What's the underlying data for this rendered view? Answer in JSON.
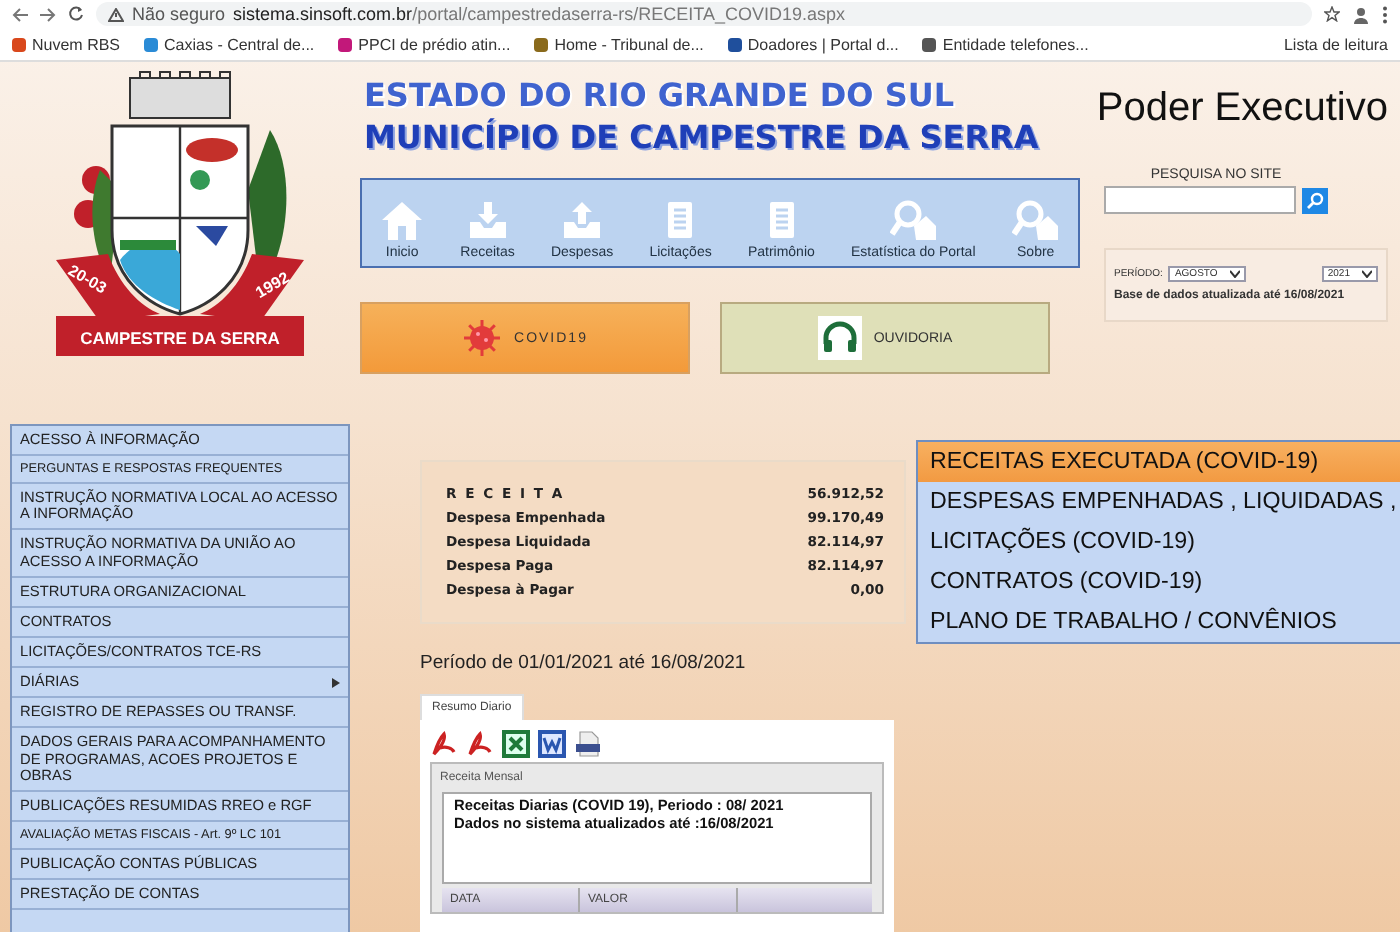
{
  "browser": {
    "security": "Não seguro",
    "url_host": "sistema.sinsoft.com.br",
    "url_path": "/portal/campestredaserra-rs/RECEITA_COVID19.aspx",
    "bookmarks": [
      {
        "label": "Nuvem RBS",
        "color": "#d9481c"
      },
      {
        "label": "Caxias - Central de...",
        "color": "#2a8bd6"
      },
      {
        "label": "PPCI de prédio atin...",
        "color": "#c2187a"
      },
      {
        "label": "Home - Tribunal de...",
        "color": "#8a6a1c"
      },
      {
        "label": "Doadores | Portal d...",
        "color": "#1f4f9c"
      },
      {
        "label": "Entidade telefones...",
        "color": "#555555"
      }
    ],
    "reading_list": "Lista de leitura"
  },
  "logo": {
    "left_date": "20-03",
    "right_date": "1992",
    "ribbon": "CAMPESTRE DA SERRA"
  },
  "header": {
    "state": "ESTADO DO RIO GRANDE DO SUL",
    "municipality": "MUNICÍPIO DE CAMPESTRE DA SERRA",
    "branch": "Poder Executivo"
  },
  "nav": [
    {
      "label": "Inicio",
      "kind": "home"
    },
    {
      "label": "Receitas",
      "kind": "in"
    },
    {
      "label": "Despesas",
      "kind": "out"
    },
    {
      "label": "Licitações",
      "kind": "doc"
    },
    {
      "label": "Patrimônio",
      "kind": "doc"
    },
    {
      "label": "Estatística do Portal",
      "kind": "search"
    },
    {
      "label": "Sobre",
      "kind": "search"
    }
  ],
  "search": {
    "label": "PESQUISA NO SITE"
  },
  "shortcuts": [
    {
      "label": "COVID19",
      "kind": "virus"
    },
    {
      "label": "OUVIDORIA",
      "kind": "headset"
    }
  ],
  "period": {
    "label": "PERÍODO:",
    "month": "AGOSTO",
    "year": "2021",
    "updated": "Base de dados atualizada até 16/08/2021"
  },
  "sidebar": [
    {
      "label": "ACESSO À INFORMAÇÃO",
      "has_submenu": false
    },
    {
      "label": "PERGUNTAS E RESPOSTAS FREQUENTES",
      "has_submenu": false
    },
    {
      "label": "INSTRUÇÃO NORMATIVA LOCAL AO ACESSO A INFORMAÇÃO",
      "has_submenu": false
    },
    {
      "label": "INSTRUÇÃO NORMATIVA DA UNIÃO AO ACESSO A INFORMAÇÃO",
      "has_submenu": false
    },
    {
      "label": "ESTRUTURA ORGANIZACIONAL",
      "has_submenu": false
    },
    {
      "label": "CONTRATOS",
      "has_submenu": false
    },
    {
      "label": "LICITAÇÕES/CONTRATOS TCE-RS",
      "has_submenu": false
    },
    {
      "label": "DIÁRIAS",
      "has_submenu": true
    },
    {
      "label": "REGISTRO DE REPASSES OU TRANSF.",
      "has_submenu": false
    },
    {
      "label": "DADOS GERAIS PARA ACOMPANHAMENTO DE PROGRAMAS, ACOES PROJETOS E OBRAS",
      "has_submenu": false
    },
    {
      "label": "PUBLICAÇÕES RESUMIDAS RREO e RGF",
      "has_submenu": false
    },
    {
      "label": "AVALIAÇÃO METAS FISCAIS - Art. 9º LC 101",
      "has_submenu": false
    },
    {
      "label": "PUBLICAÇÃO CONTAS PÚBLICAS",
      "has_submenu": false
    },
    {
      "label": "PRESTAÇÃO DE CONTAS",
      "has_submenu": false
    }
  ],
  "summary": [
    {
      "label": "R E C E I T A",
      "value": "56.912,52"
    },
    {
      "label": "Despesa Empenhada",
      "value": "99.170,49"
    },
    {
      "label": "Despesa Liquidada",
      "value": "82.114,97"
    },
    {
      "label": "Despesa Paga",
      "value": "82.114,97"
    },
    {
      "label": "Despesa à Pagar",
      "value": "0,00"
    }
  ],
  "covid_menu": [
    {
      "label": "RECEITAS EXECUTADA (COVID-19)",
      "selected": true
    },
    {
      "label": "DESPESAS EMPENHADAS , LIQUIDADAS ,",
      "selected": false
    },
    {
      "label": "LICITAÇÕES (COVID-19)",
      "selected": false
    },
    {
      "label": "CONTRATOS (COVID-19)",
      "selected": false
    },
    {
      "label": "PLANO DE TRABALHO / CONVÊNIOS",
      "selected": false
    }
  ],
  "period_text": "Período de 01/01/2021 até 16/08/2021",
  "tabs": [
    {
      "label": "Resumo Diario",
      "selected": true
    }
  ],
  "exports": [
    {
      "kind": "pdf"
    },
    {
      "kind": "pdf"
    },
    {
      "kind": "excel"
    },
    {
      "kind": "word"
    },
    {
      "kind": "txt"
    }
  ],
  "report": {
    "title": "Receita Mensal",
    "lines": [
      "Receitas Diarias (COVID 19), Periodo : 08/ 2021",
      "Dados no sistema atualizados até :16/08/2021"
    ],
    "columns": [
      "DATA",
      "VALOR"
    ]
  }
}
